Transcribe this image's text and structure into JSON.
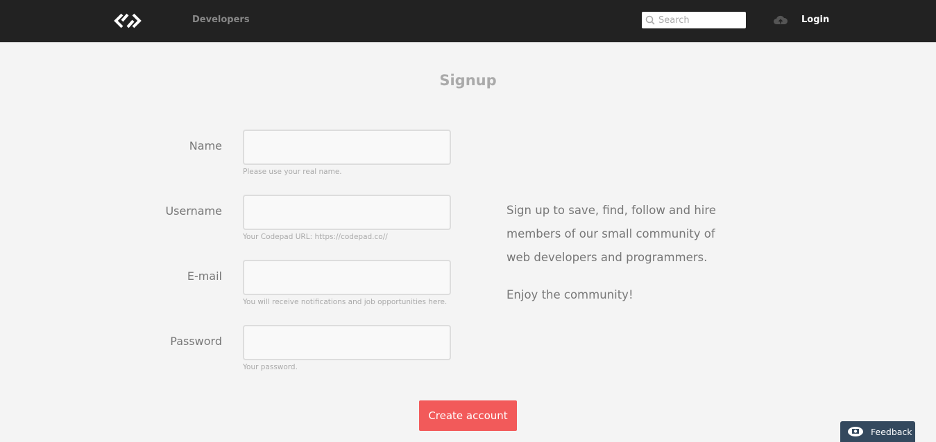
{
  "nav": {
    "developers": "Developers",
    "search_placeholder": "Search",
    "login": "Login"
  },
  "page": {
    "title": "Signup"
  },
  "form": {
    "fields": [
      {
        "label": "Name",
        "value": "",
        "help": "Please use your real name."
      },
      {
        "label": "Username",
        "value": "",
        "help": "Your Codepad URL: https://codepad.co//"
      },
      {
        "label": "E-mail",
        "value": "",
        "help": "You will receive notifications and job opportunities here."
      },
      {
        "label": "Password",
        "value": "",
        "help": "Your password."
      }
    ],
    "submit": "Create account"
  },
  "aside": {
    "text": "Sign up to save, find, follow and hire members of our small community of web developers and programmers.",
    "closing": "Enjoy the community!"
  },
  "feedback": {
    "label": "Feedback"
  },
  "colors": {
    "nav_bg": "#222222",
    "primary": "#f25a5a",
    "feedback_bg": "#34495e"
  }
}
